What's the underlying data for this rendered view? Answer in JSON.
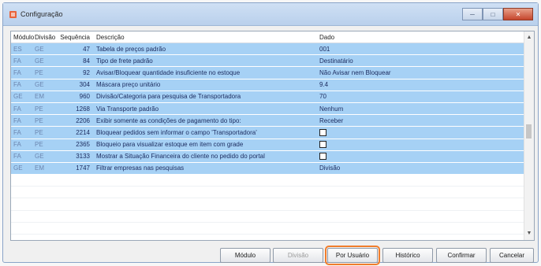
{
  "window": {
    "title": "Configuração",
    "btn_min": "─",
    "btn_max": "□",
    "btn_close": "✕"
  },
  "columns": {
    "modulo": "Módulo",
    "divisao": "Divisão",
    "sequencia": "Sequência",
    "descricao": "Descrição",
    "dado": "Dado"
  },
  "rows": [
    {
      "modulo": "ES",
      "divisao": "GE",
      "sequencia": "47",
      "descricao": "Tabela de preços padrão",
      "dado": "001"
    },
    {
      "modulo": "FA",
      "divisao": "GE",
      "sequencia": "84",
      "descricao": "Tipo de frete padrão",
      "dado": "Destinatário"
    },
    {
      "modulo": "FA",
      "divisao": "PE",
      "sequencia": "92",
      "descricao": "Avisar/Bloquear quantidade insuficiente no estoque",
      "dado": "Não Avisar nem Bloquear"
    },
    {
      "modulo": "FA",
      "divisao": "GE",
      "sequencia": "304",
      "descricao": "Máscara preço unitário",
      "dado": "9.4"
    },
    {
      "modulo": "GE",
      "divisao": "EM",
      "sequencia": "960",
      "descricao": "Divisão/Categoria para pesquisa de Transportadora",
      "dado": "70"
    },
    {
      "modulo": "FA",
      "divisao": "PE",
      "sequencia": "1268",
      "descricao": "Via Transporte padrão",
      "dado": "Nenhum"
    },
    {
      "modulo": "FA",
      "divisao": "PE",
      "sequencia": "2206",
      "descricao": "Exibir somente as condições de pagamento do tipo:",
      "dado": "Receber"
    },
    {
      "modulo": "FA",
      "divisao": "PE",
      "sequencia": "2214",
      "descricao": "Bloquear pedidos sem informar o campo 'Transportadora'",
      "dado": "",
      "checkbox": true
    },
    {
      "modulo": "FA",
      "divisao": "PE",
      "sequencia": "2365",
      "descricao": "Bloqueio para visualizar estoque em item com grade",
      "dado": "",
      "checkbox": true
    },
    {
      "modulo": "FA",
      "divisao": "GE",
      "sequencia": "3133",
      "descricao": "Mostrar a Situação Financeira do cliente no pedido do portal",
      "dado": "",
      "checkbox": true
    },
    {
      "modulo": "GE",
      "divisao": "EM",
      "sequencia": "1747",
      "descricao": "Filtrar empresas nas pesquisas",
      "dado": "Divisão"
    }
  ],
  "buttons": {
    "modulo": "Módulo",
    "divisao": "Divisão",
    "por_usuario": "Por Usuário",
    "historico": "Histórico",
    "confirmar": "Confirmar",
    "cancelar": "Cancelar"
  },
  "colors": {
    "row_bg": "#a6d1f5",
    "focus_outline": "#f07d2c"
  }
}
